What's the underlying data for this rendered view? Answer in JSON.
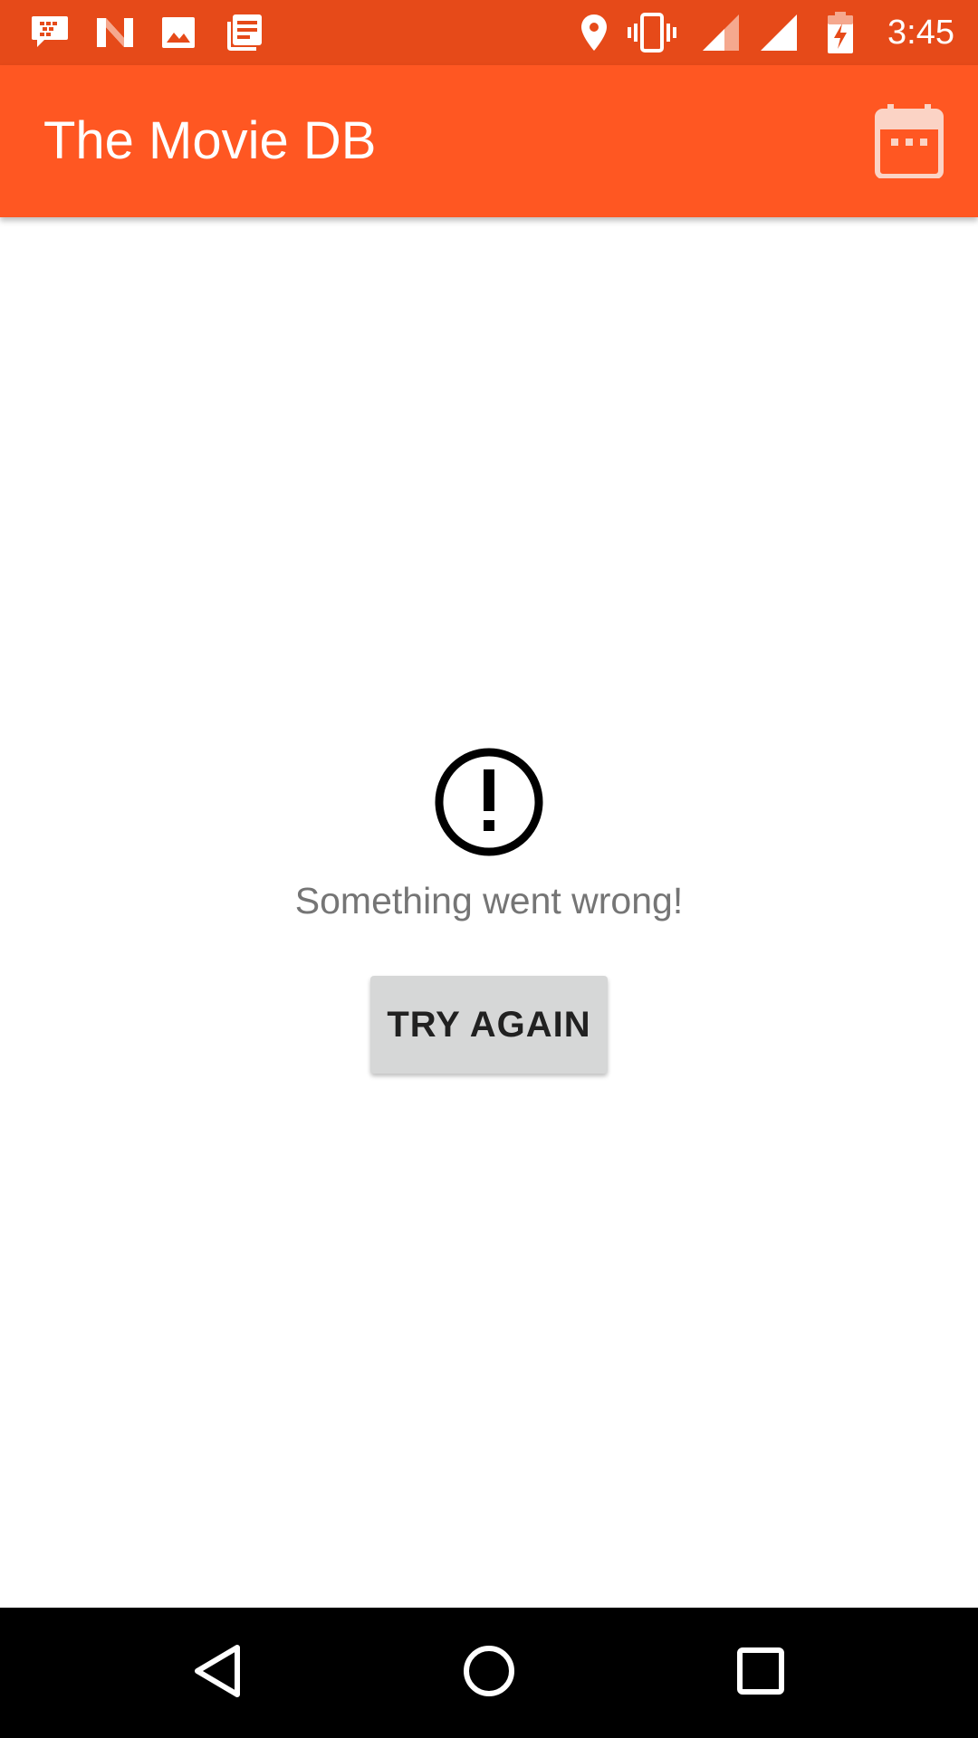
{
  "status_bar": {
    "time": "3:45",
    "left_icons": [
      "bbm-icon",
      "n-icon",
      "image-icon",
      "news-icon"
    ],
    "right_icons": [
      "location-icon",
      "vibrate-icon",
      "signal-icon",
      "signal-full-icon",
      "battery-charging-icon"
    ],
    "background": "#E64A19"
  },
  "app_bar": {
    "title": "The Movie DB",
    "action_icon": "calendar-icon",
    "background": "#FF5722"
  },
  "error_state": {
    "icon": "error-icon",
    "message": "Something went wrong!",
    "button_label": "TRY AGAIN"
  },
  "nav_bar": {
    "buttons": [
      "back-icon",
      "home-icon",
      "recents-icon"
    ]
  }
}
